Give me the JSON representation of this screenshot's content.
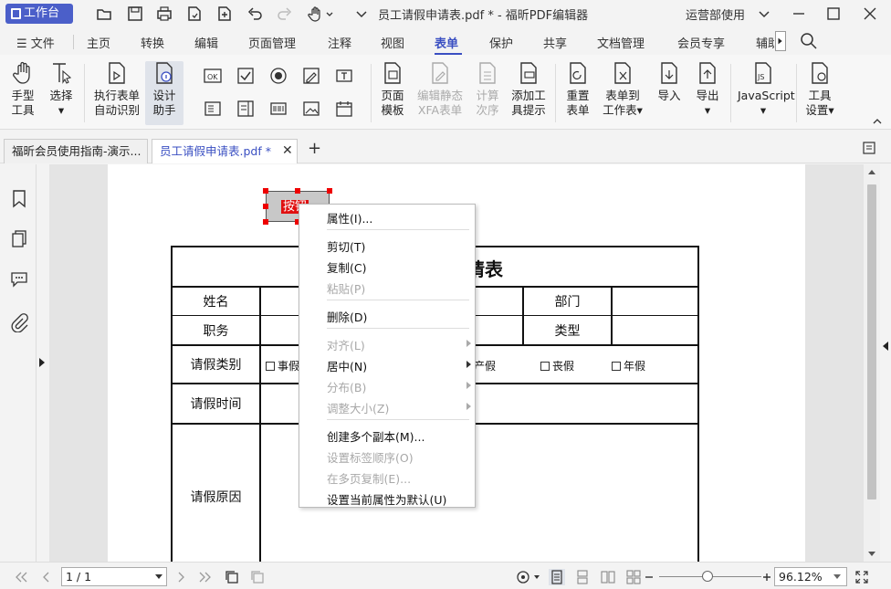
{
  "titlebar": {
    "workbench_label": "工作台",
    "doc_title": "员工请假申请表.pdf * - 福昕PDF编辑器",
    "dept_label": "运营部使用"
  },
  "menu": {
    "file": "文件",
    "tabs": [
      "主页",
      "转换",
      "编辑",
      "页面管理",
      "注释",
      "视图",
      "表单",
      "保护",
      "共享",
      "文档管理",
      "会员专享",
      "辅助"
    ],
    "active_tab": "表单"
  },
  "ribbon": {
    "hand_tool": [
      "手型",
      "工具"
    ],
    "select": "选择",
    "auto_detect": [
      "执行表单",
      "自动识别"
    ],
    "design_assist": [
      "设计",
      "助手"
    ],
    "page_template": [
      "页面",
      "模板"
    ],
    "edit_xfa": [
      "编辑静态",
      "XFA表单"
    ],
    "calc_order": [
      "计算",
      "次序"
    ],
    "add_tooltip": [
      "添加工",
      "具提示"
    ],
    "reset_form": [
      "重置",
      "表单"
    ],
    "form_to_sheet": [
      "表单到",
      "工作表"
    ],
    "import": "导入",
    "export": "导出",
    "javascript": "JavaScript",
    "tool_settings": [
      "工具",
      "设置"
    ]
  },
  "tabs": {
    "tab1": "福昕会员使用指南-演示...",
    "tab2": "员工请假申请表.pdf *"
  },
  "form": {
    "title": "员工请假申请表",
    "title_visible": "请表",
    "button_label": "按钮",
    "name": "姓名",
    "dept": "部门",
    "position": "职务",
    "type": "类型",
    "leave_category": "请假类别",
    "opt_personal": "事假",
    "opt_maternity": "产假",
    "opt_funeral": "丧假",
    "opt_annual": "年假",
    "leave_time": "请假时间",
    "leave_reason": "请假原因"
  },
  "context_menu": {
    "properties": "属性(I)...",
    "cut": "剪切(T)",
    "copy": "复制(C)",
    "paste": "粘贴(P)",
    "delete": "删除(D)",
    "align": "对齐(L)",
    "center": "居中(N)",
    "distribute": "分布(B)",
    "resize": "调整大小(Z)",
    "create_copies": "创建多个副本(M)...",
    "tab_order": "设置标签顺序(O)",
    "copy_pages": "在多页复制(E)...",
    "set_default": "设置当前属性为默认(U)"
  },
  "status": {
    "page": "1 / 1",
    "zoom": "96.12%"
  }
}
